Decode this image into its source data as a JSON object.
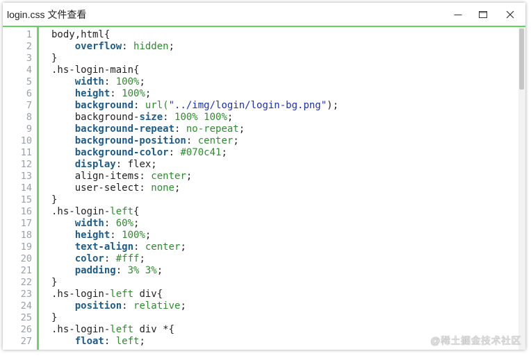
{
  "window": {
    "title": "login.css 文件查看",
    "accent_color": "#5fd35d",
    "controls": {
      "minimize": "minimize-icon",
      "maximize": "maximize-icon",
      "close": "close-icon"
    }
  },
  "editor": {
    "language": "css",
    "scroll_fraction_visible": 0.19,
    "lines": [
      [
        {
          "t": "body,html{",
          "c": "selector"
        }
      ],
      [
        {
          "t": "    ",
          "c": "plain"
        },
        {
          "t": "overflow",
          "c": "prop"
        },
        {
          "t": ": ",
          "c": "punct"
        },
        {
          "t": "hidden",
          "c": "value"
        },
        {
          "t": ";",
          "c": "punct"
        }
      ],
      [
        {
          "t": "}",
          "c": "punct"
        }
      ],
      [
        {
          "t": ".hs-login-main{",
          "c": "selector"
        }
      ],
      [
        {
          "t": "    ",
          "c": "plain"
        },
        {
          "t": "width",
          "c": "prop"
        },
        {
          "t": ": ",
          "c": "punct"
        },
        {
          "t": "100%",
          "c": "value"
        },
        {
          "t": ";",
          "c": "punct"
        }
      ],
      [
        {
          "t": "    ",
          "c": "plain"
        },
        {
          "t": "height",
          "c": "prop"
        },
        {
          "t": ": ",
          "c": "punct"
        },
        {
          "t": "100%",
          "c": "value"
        },
        {
          "t": ";",
          "c": "punct"
        }
      ],
      [
        {
          "t": "    ",
          "c": "plain"
        },
        {
          "t": "background",
          "c": "prop"
        },
        {
          "t": ": ",
          "c": "punct"
        },
        {
          "t": "url(",
          "c": "value"
        },
        {
          "t": "\"../img/login/login-bg.png\"",
          "c": "string"
        },
        {
          "t": ");",
          "c": "punct"
        }
      ],
      [
        {
          "t": "    background-",
          "c": "plain"
        },
        {
          "t": "size",
          "c": "prop"
        },
        {
          "t": ": ",
          "c": "punct"
        },
        {
          "t": "100% 100%",
          "c": "value"
        },
        {
          "t": ";",
          "c": "punct"
        }
      ],
      [
        {
          "t": "    ",
          "c": "plain"
        },
        {
          "t": "background-repeat",
          "c": "prop"
        },
        {
          "t": ": ",
          "c": "punct"
        },
        {
          "t": "no-repeat",
          "c": "value"
        },
        {
          "t": ";",
          "c": "punct"
        }
      ],
      [
        {
          "t": "    ",
          "c": "plain"
        },
        {
          "t": "background-position",
          "c": "prop"
        },
        {
          "t": ": ",
          "c": "punct"
        },
        {
          "t": "center",
          "c": "value"
        },
        {
          "t": ";",
          "c": "punct"
        }
      ],
      [
        {
          "t": "    ",
          "c": "plain"
        },
        {
          "t": "background-color",
          "c": "prop"
        },
        {
          "t": ": ",
          "c": "punct"
        },
        {
          "t": "#070c41",
          "c": "value"
        },
        {
          "t": ";",
          "c": "punct"
        }
      ],
      [
        {
          "t": "    ",
          "c": "plain"
        },
        {
          "t": "display",
          "c": "prop"
        },
        {
          "t": ": flex;",
          "c": "punct"
        }
      ],
      [
        {
          "t": "    align-items: ",
          "c": "plain"
        },
        {
          "t": "center",
          "c": "value"
        },
        {
          "t": ";",
          "c": "punct"
        }
      ],
      [
        {
          "t": "    user-select: ",
          "c": "plain"
        },
        {
          "t": "none",
          "c": "value"
        },
        {
          "t": ";",
          "c": "punct"
        }
      ],
      [
        {
          "t": "}",
          "c": "punct"
        }
      ],
      [
        {
          "t": ".hs-login-",
          "c": "selector"
        },
        {
          "t": "left",
          "c": "value"
        },
        {
          "t": "{",
          "c": "punct"
        }
      ],
      [
        {
          "t": "    ",
          "c": "plain"
        },
        {
          "t": "width",
          "c": "prop"
        },
        {
          "t": ": ",
          "c": "punct"
        },
        {
          "t": "60%",
          "c": "value"
        },
        {
          "t": ";",
          "c": "punct"
        }
      ],
      [
        {
          "t": "    ",
          "c": "plain"
        },
        {
          "t": "height",
          "c": "prop"
        },
        {
          "t": ": ",
          "c": "punct"
        },
        {
          "t": "100%",
          "c": "value"
        },
        {
          "t": ";",
          "c": "punct"
        }
      ],
      [
        {
          "t": "    ",
          "c": "plain"
        },
        {
          "t": "text-align",
          "c": "prop"
        },
        {
          "t": ": ",
          "c": "punct"
        },
        {
          "t": "center",
          "c": "value"
        },
        {
          "t": ";",
          "c": "punct"
        }
      ],
      [
        {
          "t": "    ",
          "c": "plain"
        },
        {
          "t": "color",
          "c": "prop"
        },
        {
          "t": ": ",
          "c": "punct"
        },
        {
          "t": "#fff",
          "c": "value"
        },
        {
          "t": ";",
          "c": "punct"
        }
      ],
      [
        {
          "t": "    ",
          "c": "plain"
        },
        {
          "t": "padding",
          "c": "prop"
        },
        {
          "t": ": ",
          "c": "punct"
        },
        {
          "t": "3% 3%",
          "c": "value"
        },
        {
          "t": ";",
          "c": "punct"
        }
      ],
      [
        {
          "t": "}",
          "c": "punct"
        }
      ],
      [
        {
          "t": ".hs-login-",
          "c": "selector"
        },
        {
          "t": "left",
          "c": "value"
        },
        {
          "t": " div{",
          "c": "punct"
        }
      ],
      [
        {
          "t": "    ",
          "c": "plain"
        },
        {
          "t": "position",
          "c": "prop"
        },
        {
          "t": ": ",
          "c": "punct"
        },
        {
          "t": "relative",
          "c": "value"
        },
        {
          "t": ";",
          "c": "punct"
        }
      ],
      [
        {
          "t": "}",
          "c": "punct"
        }
      ],
      [
        {
          "t": ".hs-login-",
          "c": "selector"
        },
        {
          "t": "left",
          "c": "value"
        },
        {
          "t": " div *{",
          "c": "punct"
        }
      ],
      [
        {
          "t": "    ",
          "c": "plain"
        },
        {
          "t": "float",
          "c": "prop"
        },
        {
          "t": ": ",
          "c": "punct"
        },
        {
          "t": "left",
          "c": "value"
        },
        {
          "t": ";",
          "c": "punct"
        }
      ]
    ]
  },
  "watermark": "@稀土掘金技术社区"
}
